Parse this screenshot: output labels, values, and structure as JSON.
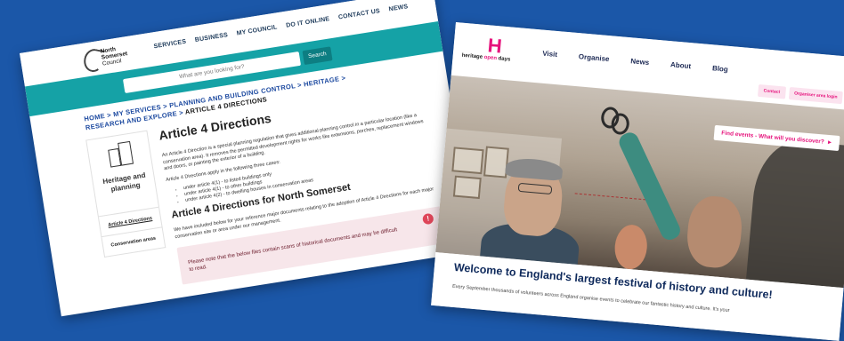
{
  "left": {
    "logo_lines": [
      "North",
      "Somerset",
      "Council"
    ],
    "nav": [
      "SERVICES",
      "BUSINESS",
      "MY COUNCIL",
      "DO IT ONLINE",
      "CONTACT US",
      "NEWS"
    ],
    "search": {
      "placeholder": "What are you looking for?",
      "button": "Search"
    },
    "breadcrumb": {
      "items": [
        "HOME",
        "MY SERVICES",
        "PLANNING AND BUILDING CONTROL",
        "HERITAGE",
        "RESEARCH AND EXPLORE"
      ],
      "separator": ">",
      "current": "ARTICLE 4 DIRECTIONS"
    },
    "sidebar": {
      "title": "Heritage and planning",
      "links": [
        "Article 4 Directions",
        "Conservation areas"
      ]
    },
    "main": {
      "title": "Article 4 Directions",
      "intro": "An Article 4 Direction is a special planning regulation that gives additional planning control in a particular location (like a conservation area). It removes the permitted development rights for works like extensions, porches, replacement windows and doors, or painting the exterior of a building.",
      "applies": "Article 4 Directions apply in the following three cases:",
      "bullets": [
        "under article 4(1) - to listed buildings only",
        "under article 4(1) - to other buildings",
        "under article 4(2) - to dwelling houses in conservation areas"
      ],
      "subtitle": "Article 4 Directions for North Somerset",
      "sub_intro": "We have included below for your reference major documents relating to the adoption of Article 4 Directions for each major conservation site or area under our management.",
      "note": "Please note that the below files contain scans of historical documents and may be difficult to read.",
      "alert_icon": "!"
    }
  },
  "right": {
    "logo": {
      "mark": "H",
      "word_a": "heritage ",
      "word_b": "open",
      "word_c": " days"
    },
    "nav": [
      "Visit",
      "Organise",
      "News",
      "About",
      "Blog"
    ],
    "util": [
      "Contact",
      "Organiser area login"
    ],
    "cta": "Find events - What will you discover?",
    "cta_arrow": "►",
    "headline": "Welcome to England's largest festival of history and culture!",
    "body": "Every September thousands of volunteers across England organise events to celebrate our fantastic history and culture. It's your"
  }
}
